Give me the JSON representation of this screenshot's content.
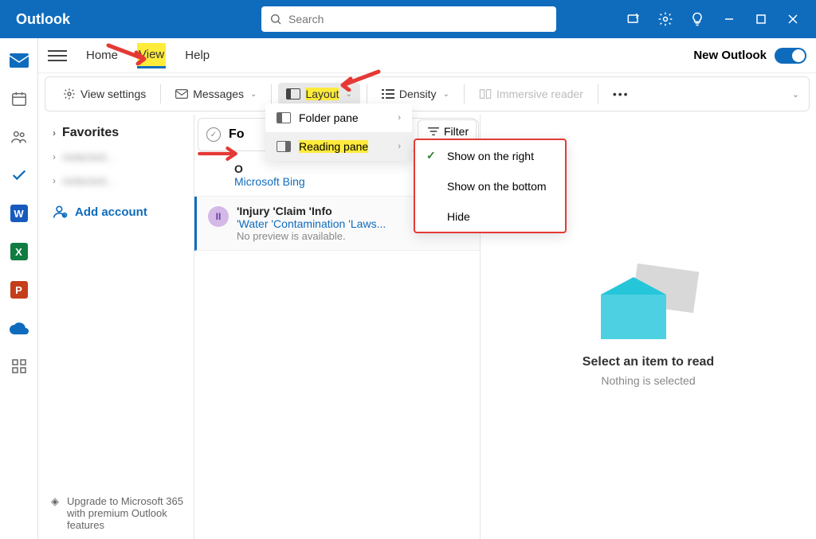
{
  "app_title": "Outlook",
  "search_placeholder": "Search",
  "tabs": {
    "home": "Home",
    "view": "View",
    "help": "Help"
  },
  "new_outlook_label": "New Outlook",
  "ribbon": {
    "view_settings": "View settings",
    "messages": "Messages",
    "layout": "Layout",
    "density": "Density",
    "immersive": "Immersive reader"
  },
  "layout_menu": {
    "folder_pane": "Folder pane",
    "reading_pane": "Reading pane"
  },
  "reading_pane_menu": {
    "right": "Show on the right",
    "bottom": "Show on the bottom",
    "hide": "Hide"
  },
  "filter_label": "Filter",
  "folders": {
    "favorites": "Favorites",
    "item1": "redacted...",
    "item2": "redacted...",
    "add_account": "Add account"
  },
  "messages": [
    {
      "title_partial": "O",
      "sender": "Microsoft Bing"
    },
    {
      "initials": "II",
      "title": "'Injury 'Claim 'Info",
      "sub": "'Water 'Contamination 'Laws...",
      "preview": "No preview is available."
    }
  ],
  "reading": {
    "title": "Select an item to read",
    "sub": "Nothing is selected"
  },
  "upgrade": "Upgrade to Microsoft 365 with premium Outlook features",
  "focused_partial": "Fo"
}
